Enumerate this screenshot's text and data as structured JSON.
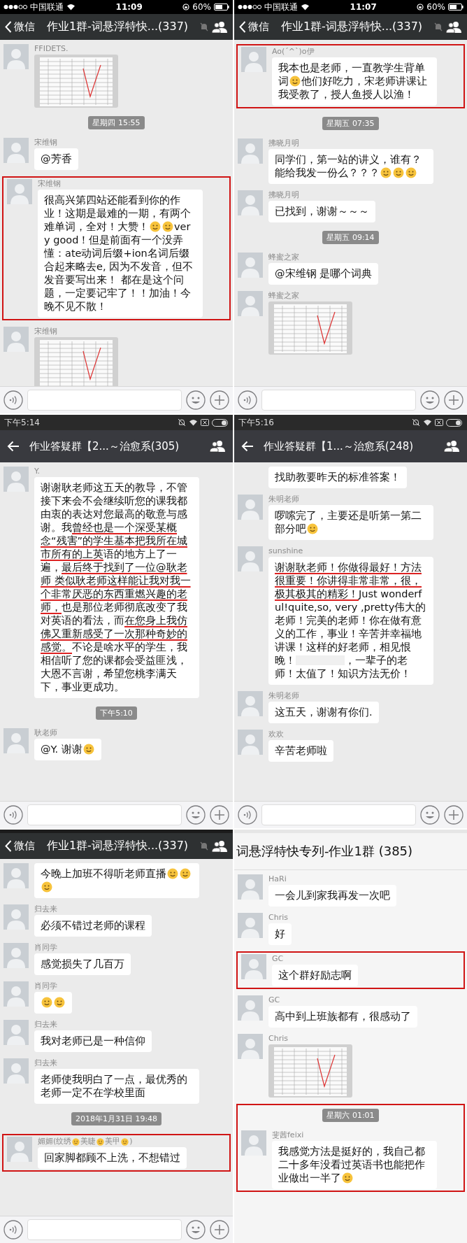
{
  "panels": [
    {
      "status_bar": {
        "kind": "ios",
        "carrier": "中国联通",
        "time": "11:09",
        "battery": "60%"
      },
      "nav": {
        "kind": "ios",
        "back_label": "微信",
        "title": "作业1群-词悬浮特快...(337)",
        "muted": true
      },
      "messages": [
        {
          "kind": "image",
          "sender": "FFIDETS.",
          "avatar": true,
          "highlighted": false
        },
        {
          "kind": "time",
          "text": "星期四 15:55",
          "highlighted": false
        },
        {
          "kind": "text",
          "sender": "宋维钢",
          "avatar": true,
          "text": "@芳香",
          "highlighted": false
        },
        {
          "kind": "text",
          "sender": "宋维钢",
          "avatar": true,
          "parts": [
            {
              "kind": "text",
              "text": "很高兴第四站还能看到你的作业！这期是最难的一期，有两个难单词，全对！大赞！"
            },
            {
              "kind": "emoji"
            },
            {
              "kind": "emoji"
            },
            {
              "kind": "text",
              "text": "very good！但是前面有一个没弄懂：ate动词后缀+ion名词后缀合起来略去e, 因为不发音，但不发音要写出来！ 都在是这个问题，一定要记牢了！！加油！今晚不见不散！"
            }
          ],
          "highlighted": true
        },
        {
          "kind": "image",
          "sender": "宋维钢",
          "avatar": true,
          "highlighted": false
        }
      ],
      "input_bar": true
    },
    {
      "status_bar": {
        "kind": "ios",
        "carrier": "中国联通",
        "time": "11:07",
        "battery": "60%"
      },
      "nav": {
        "kind": "ios",
        "back_label": "微信",
        "title": "作业1群-词悬浮特快...(337)",
        "muted": true
      },
      "messages": [
        {
          "kind": "text",
          "sender": "Ao(ˊ^ˋ)o伊",
          "avatar": true,
          "parts": [
            {
              "kind": "text",
              "text": "我本也是老师，一直教学生背单词"
            },
            {
              "kind": "emoji"
            },
            {
              "kind": "text",
              "text": "他们好吃力，宋老师讲课让我受教了，授人鱼授人以渔！"
            }
          ],
          "highlighted": true
        },
        {
          "kind": "time",
          "text": "星期五 07:35",
          "highlighted": false
        },
        {
          "kind": "text",
          "sender": "拂晓月明",
          "avatar": true,
          "parts": [
            {
              "kind": "text",
              "text": "同学们，第一站的讲义，谁有？能给我发一份么？？？"
            },
            {
              "kind": "emoji"
            },
            {
              "kind": "emoji"
            },
            {
              "kind": "emoji"
            }
          ],
          "highlighted": false
        },
        {
          "kind": "text",
          "sender": "拂晓月明",
          "avatar": true,
          "text": "已找到，谢谢～～～",
          "highlighted": false
        },
        {
          "kind": "time",
          "text": "星期五 09:14",
          "highlighted": false
        },
        {
          "kind": "text",
          "sender": "蜂蜜之家",
          "avatar": true,
          "text": "@宋维钢 是哪个词典",
          "highlighted": false
        },
        {
          "kind": "image",
          "sender": "蜂蜜之家",
          "avatar": true,
          "highlighted": false
        }
      ],
      "input_bar": true
    },
    {
      "status_bar": {
        "kind": "android",
        "time": "下午5:14"
      },
      "nav": {
        "kind": "android",
        "title": "作业答疑群【2...～治愈系(305)"
      },
      "messages": [
        {
          "kind": "text",
          "sender": "Y.",
          "avatar": true,
          "parts": [
            {
              "kind": "text",
              "text": "谢谢耿老师这五天的教导，不管接下来会不会继续听您的课我都由衷的表达对您最高的敬意与感谢。我",
              "underlined": false
            },
            {
              "kind": "text",
              "text": "曾经也是一个深受某概念“残害”的学生基本把我所在城市所有的上英",
              "underlined": true
            },
            {
              "kind": "text",
              "text": "语的地方上了一遍，",
              "underlined": false
            },
            {
              "kind": "text",
              "text": "最后终于找到了一位@耿老师 类似耿老师这样能让我对我一个非常厌恶的东西重燃兴趣的老师，",
              "underlined": true
            },
            {
              "kind": "text",
              "text": "也是那位老师彻底改变了我对英语的看法，而",
              "underlined": false
            },
            {
              "kind": "text",
              "text": "在您身上我仿佛又重新感受了一次那种奇妙的感觉。",
              "underlined": true
            },
            {
              "kind": "text",
              "text": "不论是啥水平的学生，我相信听了您的课都会受益匪浅，大恩不言谢，希望您桃李满天下，事业更成功。",
              "underlined": false
            }
          ],
          "highlighted": false
        },
        {
          "kind": "time",
          "text": "下午5:10",
          "highlighted": false
        },
        {
          "kind": "text",
          "sender": "耿老师",
          "avatar": true,
          "parts": [
            {
              "kind": "text",
              "text": "@Y. 谢谢"
            },
            {
              "kind": "emoji"
            }
          ],
          "highlighted": false
        }
      ],
      "input_bar": true
    },
    {
      "status_bar": {
        "kind": "android",
        "time": "下午5:16"
      },
      "nav": {
        "kind": "android",
        "title": "作业答疑群【1...～治愈系(248)"
      },
      "messages": [
        {
          "kind": "text",
          "avatar": false,
          "text": "找助教要昨天的标准答案！",
          "highlighted": false
        },
        {
          "kind": "text",
          "sender": "朱明老师",
          "avatar": true,
          "parts": [
            {
              "kind": "text",
              "text": "啰嗦完了，主要还是听第一第二部分吧"
            },
            {
              "kind": "emoji"
            }
          ],
          "highlighted": false
        },
        {
          "kind": "text",
          "sender": "sunshine",
          "avatar": true,
          "parts": [
            {
              "kind": "text",
              "text": "谢谢耿老师！你做得最好！方法很重要！你讲得非常非常，很，极其极其的精彩！",
              "underlined": true
            },
            {
              "kind": "text",
              "text": "Just wonderful!quite,so, very ,pretty伟大的老师！完美的老师！你在做有意义的工作，事业！辛苦并幸福地讲课！这样的好老师，相见恨晚！",
              "underlined": false
            },
            {
              "kind": "blurred"
            },
            {
              "kind": "text",
              "text": "，一辈子的老师！太值了！知识方法无价！",
              "underlined": false
            }
          ],
          "highlighted": false
        },
        {
          "kind": "text",
          "sender": "朱明老师",
          "avatar": true,
          "text": "这五天，谢谢有你们.",
          "highlighted": false
        },
        {
          "kind": "text",
          "sender": "欢欢",
          "avatar": true,
          "text": "辛苦老师啦",
          "highlighted": false
        }
      ],
      "input_bar": true
    },
    {
      "status_bar": {
        "kind": "cut"
      },
      "nav": {
        "kind": "ios",
        "back_label": "微信",
        "title": "作业1群-词悬浮特快...(337)",
        "muted": true
      },
      "messages": [
        {
          "kind": "text",
          "avatar": true,
          "parts": [
            {
              "kind": "text",
              "text": "今晚上加班不得听老师直播"
            },
            {
              "kind": "emoji"
            },
            {
              "kind": "emoji"
            },
            {
              "kind": "emoji"
            }
          ],
          "highlighted": false
        },
        {
          "kind": "text",
          "sender": "归去来",
          "avatar": true,
          "text": "必须不错过老师的课程",
          "highlighted": false
        },
        {
          "kind": "text",
          "sender": "肖同学",
          "avatar": true,
          "text": "感觉损失了几百万",
          "highlighted": false
        },
        {
          "kind": "text",
          "sender": "肖同学",
          "avatar": true,
          "parts": [
            {
              "kind": "emoji"
            },
            {
              "kind": "emoji"
            }
          ],
          "highlighted": false
        },
        {
          "kind": "text",
          "sender": "归去来",
          "avatar": true,
          "text": "我对老师已是一种信仰",
          "highlighted": false
        },
        {
          "kind": "text",
          "sender": "归去来",
          "avatar": true,
          "text": "老师使我明白了一点，最优秀的老师一定不在学校里面",
          "highlighted": false
        },
        {
          "kind": "time",
          "text": "2018年1月31日 19:48",
          "highlighted": false
        },
        {
          "kind": "text",
          "sender_parts": [
            {
              "kind": "text",
              "text": "媚媚(纹绣"
            },
            {
              "kind": "emoji"
            },
            {
              "kind": "text",
              "text": "美睫"
            },
            {
              "kind": "emoji"
            },
            {
              "kind": "text",
              "text": "美甲"
            },
            {
              "kind": "emoji"
            },
            {
              "kind": "text",
              "text": ")"
            }
          ],
          "avatar": true,
          "text": "回家脚都顾不上洗，不想错过",
          "highlighted": true
        }
      ],
      "input_bar": true
    },
    {
      "status_bar": {
        "kind": "cut"
      },
      "nav": {
        "kind": "pc",
        "title": "词悬浮特快专列-作业1群 (385)"
      },
      "messages": [
        {
          "kind": "text",
          "sender": "HaRi",
          "avatar": true,
          "text": "一会儿到家我再发一次吧",
          "highlighted": false
        },
        {
          "kind": "text",
          "sender": "Chris",
          "avatar": true,
          "text": "好",
          "highlighted": false
        },
        {
          "kind": "text",
          "sender": "GC",
          "avatar": true,
          "text": "这个群好励志啊",
          "highlighted": true
        },
        {
          "kind": "text",
          "sender": "GC",
          "avatar": true,
          "text": "高中到上班族都有，很感动了",
          "highlighted": false
        },
        {
          "kind": "image",
          "sender": "Chris",
          "avatar": true,
          "highlighted": false
        },
        {
          "kind": "time",
          "text": "星期六 01:01",
          "highlighted": true
        },
        {
          "kind": "text",
          "sender": "斐茜feixi",
          "avatar": true,
          "parts": [
            {
              "kind": "text",
              "text": "我感觉方法是挺好的，我自己都二十多年没看过英语书也能把作业做出一半了"
            },
            {
              "kind": "emoji"
            }
          ],
          "highlighted": true
        }
      ],
      "input_bar": false
    }
  ]
}
